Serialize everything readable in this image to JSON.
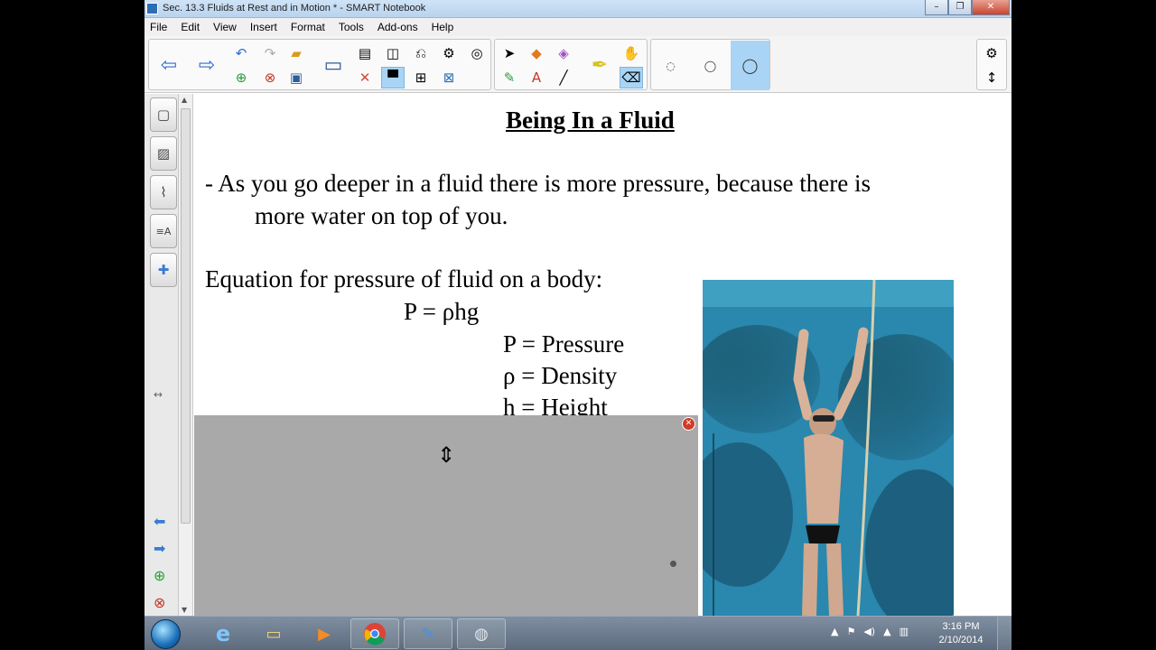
{
  "window": {
    "title": "Sec. 13.3 Fluids at Rest and in Motion * - SMART Notebook",
    "controls": {
      "minimize": "–",
      "maximize": "❐",
      "close": "✕"
    }
  },
  "menu": [
    "File",
    "Edit",
    "View",
    "Insert",
    "Format",
    "Tools",
    "Add-ons",
    "Help"
  ],
  "slide": {
    "title": "Being In a Fluid",
    "bullet_line1": "- As you go deeper in a fluid there is more pressure, because there is",
    "bullet_line2": "more water on top of you.",
    "equation_heading": "Equation for pressure of fluid on a body:",
    "equation": "P = ρhg",
    "defs": [
      "P = Pressure",
      "ρ = Density",
      "h = Height"
    ]
  },
  "taskbar": {
    "time": "3:16 PM",
    "date": "2/10/2014"
  },
  "colors": {
    "accent": "#3a7bd5",
    "selected": "#a9d4f5",
    "screen_shade": "#a9a9a9",
    "taskbar": "#5c6b7d"
  }
}
